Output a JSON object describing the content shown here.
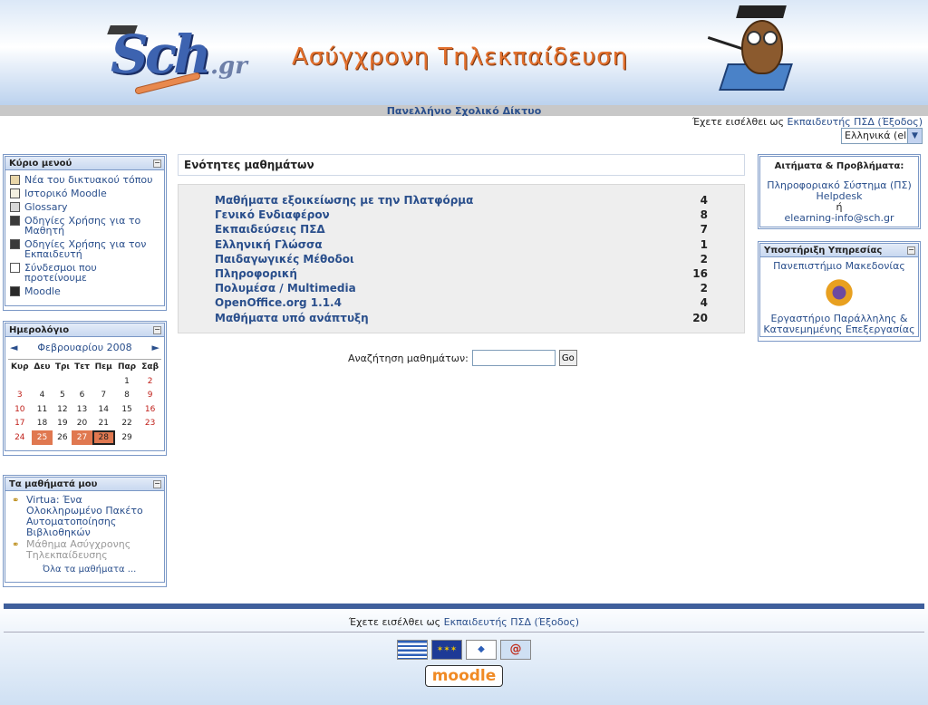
{
  "header": {
    "logo_main": "Sch",
    "logo_suffix": ".gr",
    "site_title": "Ασύγχρονη Τηλεκπαίδευση",
    "network_name": "Πανελλήνιο Σχολικό Δίκτυο"
  },
  "login": {
    "prefix": "Έχετε εισέλθει ως",
    "user": "Εκπαιδευτής ΠΣΔ",
    "logout": "(Έξοδος)"
  },
  "language": {
    "selected": "Ελληνικά (el)"
  },
  "main_menu": {
    "title": "Κύριο μενού",
    "items": [
      {
        "label": "Νέα του δικτυακού τόπου",
        "icon": "news-icon"
      },
      {
        "label": "Ιστορικό Moodle",
        "icon": "document-icon"
      },
      {
        "label": "Glossary",
        "icon": "glossary-icon"
      },
      {
        "label": "Οδηγίες Χρήσης για το Μαθητή",
        "icon": "resource-icon"
      },
      {
        "label": "Οδηγίες Χρήσης για τον Εκπαιδευτή",
        "icon": "resource-icon"
      },
      {
        "label": "Σύνδεσμοι που προτείνουμε",
        "icon": "page-icon"
      },
      {
        "label": "Moodle",
        "icon": "moodle-icon"
      }
    ]
  },
  "calendar": {
    "title": "Ημερολόγιο",
    "month": "Φεβρουαρίου 2008",
    "prev": "◄",
    "next": "►",
    "weekdays": [
      "Κυρ",
      "Δευ",
      "Τρι",
      "Τετ",
      "Πεμ",
      "Παρ",
      "Σαβ"
    ],
    "weeks": [
      [
        "",
        "",
        "",
        "",
        "",
        "1",
        "2"
      ],
      [
        "3",
        "4",
        "5",
        "6",
        "7",
        "8",
        "9"
      ],
      [
        "10",
        "11",
        "12",
        "13",
        "14",
        "15",
        "16"
      ],
      [
        "17",
        "18",
        "19",
        "20",
        "21",
        "22",
        "23"
      ],
      [
        "24",
        "25",
        "26",
        "27",
        "28",
        "29",
        ""
      ]
    ],
    "event_days": [
      "25",
      "27"
    ],
    "today": "28"
  },
  "my_courses": {
    "title": "Τα μαθήματά μου",
    "items": [
      {
        "label": "Virtua: Ένα Ολοκληρωμένο Πακέτο Αυτοματοποίησης Βιβλιοθηκών",
        "dimmed": false
      },
      {
        "label": "Μάθημα Ασύγχρονης Τηλεκπαίδευσης",
        "dimmed": true
      }
    ],
    "all_link": "Όλα τα μαθήματα ..."
  },
  "categories": {
    "title": "Ενότητες μαθημάτων",
    "rows": [
      {
        "name": "Μαθήματα εξοικείωσης με την Πλατφόρμα",
        "count": "4"
      },
      {
        "name": "Γενικό Ενδιαφέρον",
        "count": "8"
      },
      {
        "name": "Εκπαιδεύσεις ΠΣΔ",
        "count": "7"
      },
      {
        "name": "Ελληνική Γλώσσα",
        "count": "1"
      },
      {
        "name": "Παιδαγωγικές Μέθοδοι",
        "count": "2"
      },
      {
        "name": "Πληροφορική",
        "count": "16"
      },
      {
        "name": "Πολυμέσα / Multimedia",
        "count": "2"
      },
      {
        "name": "OpenOffice.org 1.1.4",
        "count": "4"
      },
      {
        "name": "Μαθήματα υπό ανάπτυξη",
        "count": "20"
      }
    ]
  },
  "search": {
    "label": "Αναζήτηση μαθημάτων:",
    "button": "Go",
    "value": ""
  },
  "requests": {
    "title": "Αιτήματα & Προβλήματα:",
    "line1": "Πληροφοριακό Σύστημα (ΠΣ)",
    "line2": "Helpdesk",
    "line3": "ή",
    "line4": "elearning-info@sch.gr"
  },
  "support": {
    "title": "Υποστήριξη Υπηρεσίας",
    "university": "Πανεπιστήμιο Μακεδονίας",
    "lab": "Εργαστήριο Παράλληλης & Κατανεμημένης Επεξεργασίας"
  },
  "footer": {
    "prefix": "Έχετε εισέλθει ως",
    "user": "Εκπαιδευτής ΠΣΔ",
    "logout": "(Έξοδος)",
    "moodle": "moodle"
  }
}
